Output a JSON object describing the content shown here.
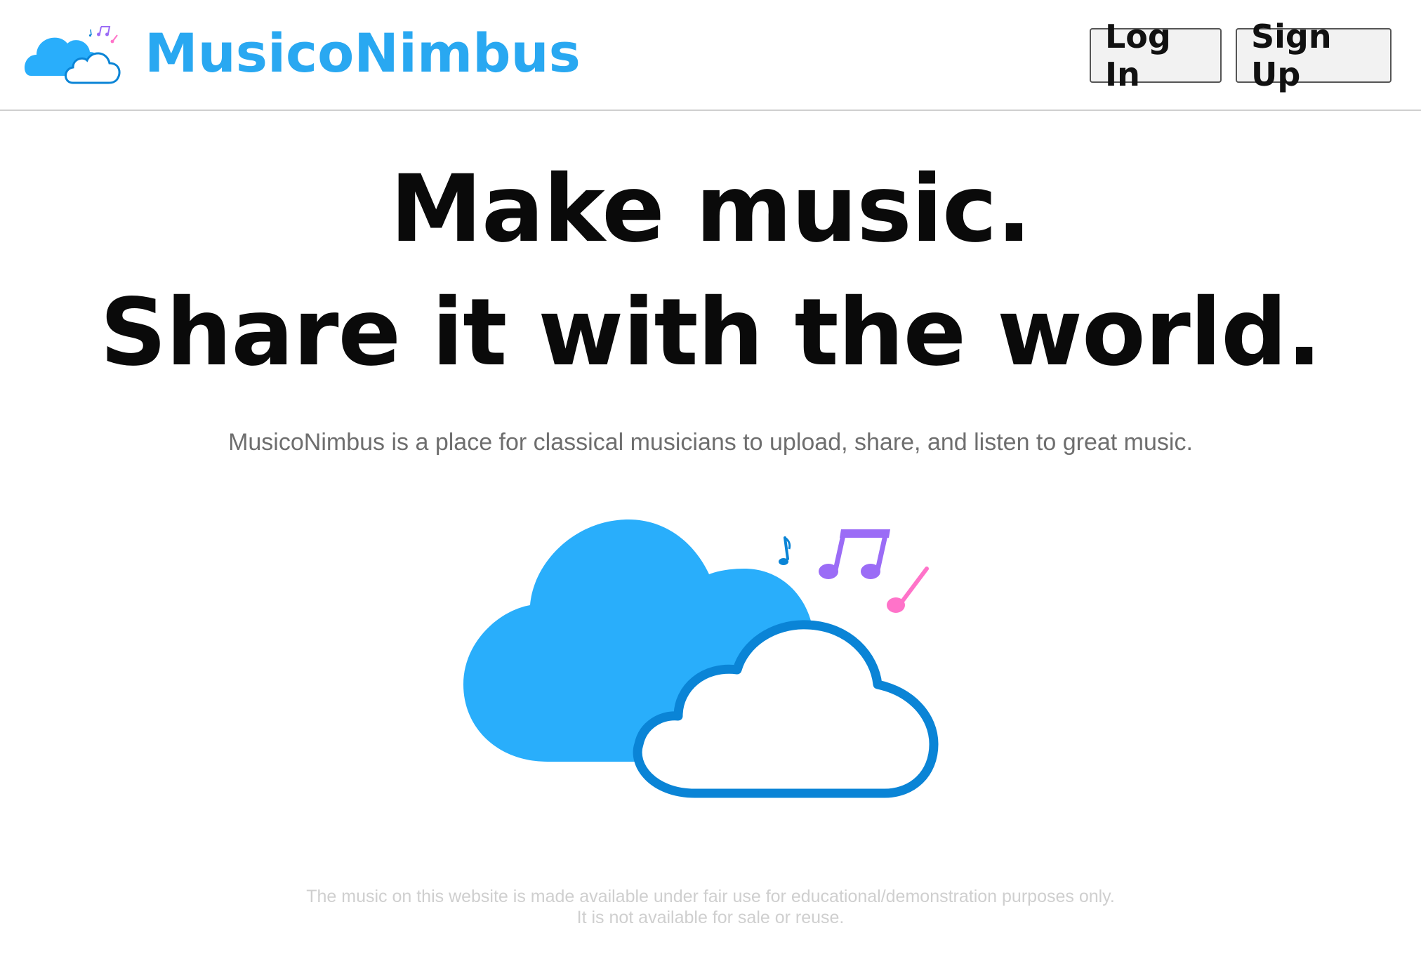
{
  "header": {
    "brand_name": "MusicoNimbus",
    "login_label": "Log In",
    "signup_label": "Sign Up"
  },
  "hero": {
    "line1": "Make music.",
    "line2": "Share it with the world.",
    "tagline": "MusicoNimbus is a place for classical musicians to upload, share, and listen to great music."
  },
  "illustration": {
    "icons": [
      "cloud-icon",
      "cloud-outline-icon",
      "eighth-note-icon",
      "beamed-notes-icon"
    ],
    "colors": {
      "cloud_fill": "#29aefb",
      "cloud_outline": "#0a84d6",
      "note_blue": "#0a84d6",
      "note_purple": "#9b6cf6",
      "note_pink": "#ff73c9"
    }
  },
  "footer": {
    "line1": "The music on this website is made available under fair use for educational/demonstration purposes only.",
    "line2": "It is not available for sale or reuse."
  },
  "theme": {
    "brand_color": "#29a8f1",
    "text_dark": "#0a0a0a",
    "text_muted": "#6e6e6e",
    "text_faint": "#cfcfcf"
  }
}
